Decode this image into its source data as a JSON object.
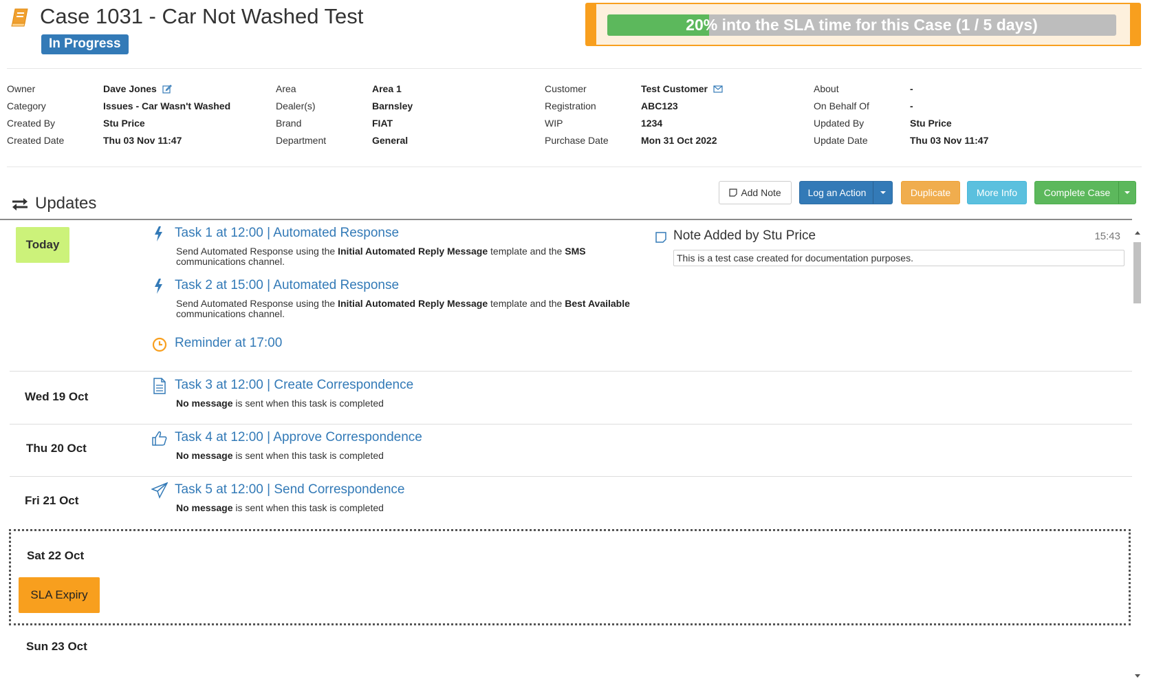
{
  "header": {
    "case_title": "Case 1031 - Car Not Washed Test",
    "status": "In Progress",
    "case_icon": "book-icon",
    "sla_text": "20% into the SLA time for this Case (1 / 5 days)",
    "sla_percent": 20
  },
  "details": {
    "col1": [
      {
        "label": "Owner",
        "value": "Dave Jones"
      },
      {
        "label": "Category",
        "value": "Issues - Car Wasn't Washed"
      },
      {
        "label": "Created By",
        "value": "Stu Price"
      },
      {
        "label": "Created Date",
        "value": "Thu 03 Nov 11:47"
      }
    ],
    "col2": [
      {
        "label": "Area",
        "value": "Area 1"
      },
      {
        "label": "Dealer(s)",
        "value": "Barnsley"
      },
      {
        "label": "Brand",
        "value": "FIAT"
      },
      {
        "label": "Department",
        "value": "General"
      }
    ],
    "col3": [
      {
        "label": "Customer",
        "value": "Test Customer"
      },
      {
        "label": "Registration",
        "value": "ABC123"
      },
      {
        "label": "WIP",
        "value": "1234"
      },
      {
        "label": "Purchase Date",
        "value": "Mon 31 Oct 2022"
      }
    ],
    "col4": [
      {
        "label": "About",
        "value": "-"
      },
      {
        "label": "On Behalf Of",
        "value": "-"
      },
      {
        "label": "Updated By",
        "value": "Stu Price"
      },
      {
        "label": "Update Date",
        "value": "Thu 03 Nov 11:47"
      }
    ]
  },
  "updates": {
    "title": "Updates",
    "buttons": {
      "add_note": "Add Note",
      "log_action": "Log an Action",
      "duplicate": "Duplicate",
      "more_info": "More Info",
      "complete_case": "Complete Case"
    }
  },
  "timeline": {
    "today_label": "Today",
    "today_tasks": [
      {
        "title": "Task 1 at 12:00 | Automated Response",
        "icon": "lightning-icon",
        "desc_pre": "Send Automated Response using the ",
        "desc_bold1": "Initial Automated Reply Message",
        "desc_mid": " template and the ",
        "desc_bold2": "SMS",
        "desc_post": " communications channel."
      },
      {
        "title": "Task 2 at 15:00 | Automated Response",
        "icon": "lightning-icon",
        "desc_pre": "Send Automated Response using the ",
        "desc_bold1": "Initial Automated Reply Message",
        "desc_mid": " template and the ",
        "desc_bold2": "Best Available",
        "desc_post": " communications channel."
      }
    ],
    "reminder": {
      "title": "Reminder at 17:00",
      "icon": "clock-icon"
    },
    "note": {
      "title": "Note Added by Stu Price",
      "time": "15:43",
      "body": "This is a test case created for documentation purposes."
    },
    "days": [
      {
        "day": "Wed 19 Oct",
        "task_title": "Task 3 at 12:00 | Create Correspondence",
        "icon": "document-icon",
        "desc_bold": "No message",
        "desc_rest": " is sent when this task is completed"
      },
      {
        "day": "Thu 20 Oct",
        "task_title": "Task 4 at 12:00 | Approve Correspondence",
        "icon": "thumbs-up-icon",
        "desc_bold": "No message",
        "desc_rest": " is sent when this task is completed"
      },
      {
        "day": "Fri 21 Oct",
        "task_title": "Task 5 at 12:00 | Send Correspondence",
        "icon": "paper-plane-icon",
        "desc_bold": "No message",
        "desc_rest": " is sent when this task is completed"
      }
    ],
    "sla_day": "Sat 22 Oct",
    "sla_expiry": "SLA Expiry",
    "last_day": "Sun 23 Oct"
  },
  "colors": {
    "primary": "#337ab7",
    "sla_orange": "#f89f1e",
    "sla_green": "#5cb85c",
    "today_green": "#ccf27a",
    "duplicate": "#f0ad4e",
    "more_info": "#5bc0de",
    "complete": "#5cb85c"
  }
}
